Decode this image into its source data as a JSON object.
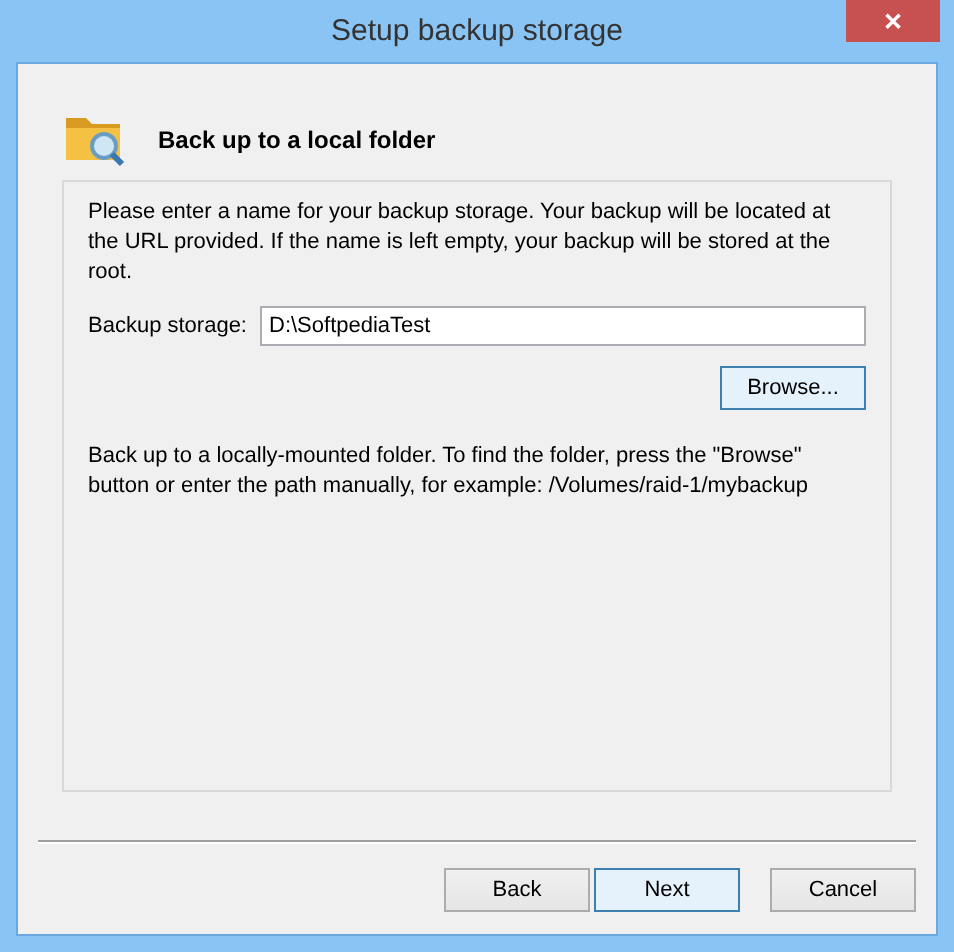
{
  "window": {
    "title": "Setup backup storage",
    "close": "✕"
  },
  "header": {
    "title": "Back up to a local folder"
  },
  "intro": "Please enter a name for your backup storage. Your backup will be located at the URL provided. If the name is left empty, your backup will be stored at the root.",
  "field": {
    "label": "Backup storage:",
    "value": "D:\\SoftpediaTest"
  },
  "browse": {
    "label": "Browse...",
    "highlighted": true
  },
  "help": "Back up to a locally-mounted folder. To find the folder, press the \"Browse\" button or enter the path manually, for example: /Volumes/raid-1/mybackup",
  "buttons": [
    {
      "label": "Back",
      "highlighted": false
    },
    {
      "label": "Next",
      "highlighted": true
    },
    {
      "label": "Cancel",
      "highlighted": false
    }
  ]
}
